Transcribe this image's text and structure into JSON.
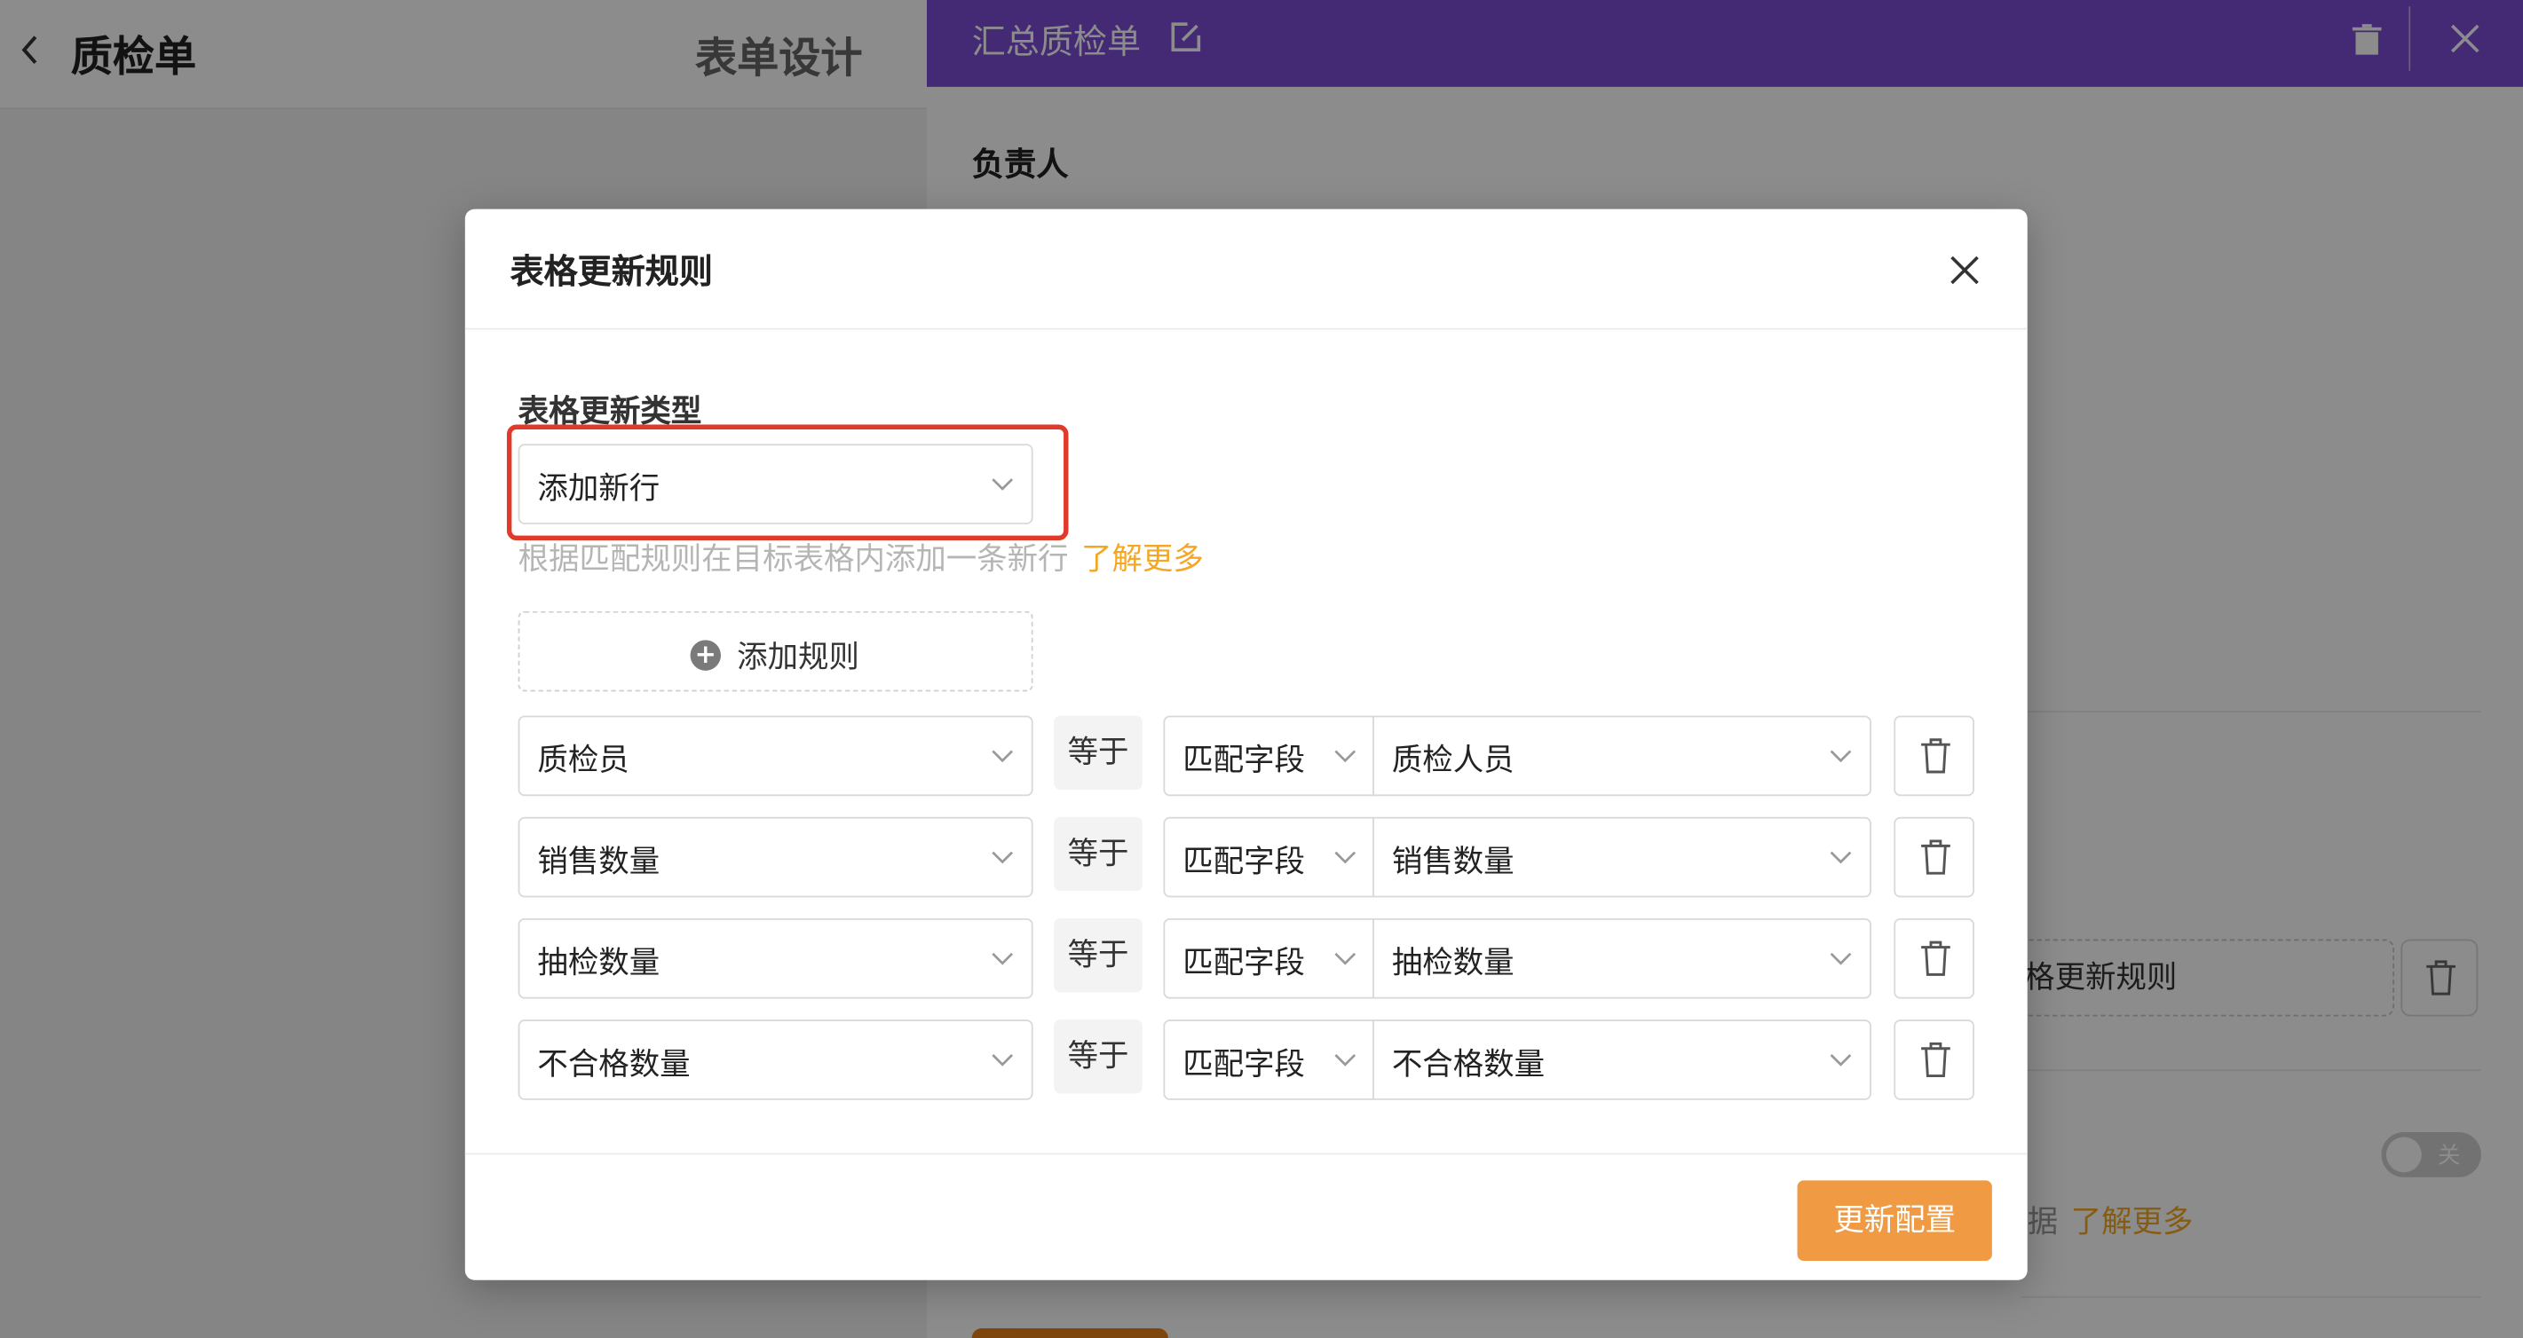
{
  "page": {
    "back_icon": "chevron-left-icon",
    "title": "质检单",
    "design_tab": "表单设计"
  },
  "drawer": {
    "title": "汇总质检单",
    "edit_icon": "edit-icon",
    "delete_icon": "trash-icon",
    "close_icon": "close-icon",
    "owner_label": "负责人",
    "rule_button_partial": "格更新规则",
    "toggle_text": "关",
    "toggle_on": false,
    "hint_partial": "据",
    "hint_link": "了解更多"
  },
  "modal": {
    "title": "表格更新规则",
    "close_icon": "close-icon",
    "type_label": "表格更新类型",
    "type_value": "添加新行",
    "description": "根据匹配规则在目标表格内添加一条新行",
    "learn_more": "了解更多",
    "add_rule_icon": "plus-circle-icon",
    "add_rule_label": "添加规则",
    "rules": [
      {
        "field": "质检员",
        "operator": "等于",
        "mode": "匹配字段",
        "target": "质检人员"
      },
      {
        "field": "销售数量",
        "operator": "等于",
        "mode": "匹配字段",
        "target": "销售数量"
      },
      {
        "field": "抽检数量",
        "operator": "等于",
        "mode": "匹配字段",
        "target": "抽检数量"
      },
      {
        "field": "不合格数量",
        "operator": "等于",
        "mode": "匹配字段",
        "target": "不合格数量"
      }
    ],
    "confirm_label": "更新配置"
  },
  "colors": {
    "drawer_header": "#7d4ed6",
    "primary_button": "#f09a43",
    "link": "#f5a623",
    "highlight": "#e23a2a"
  }
}
